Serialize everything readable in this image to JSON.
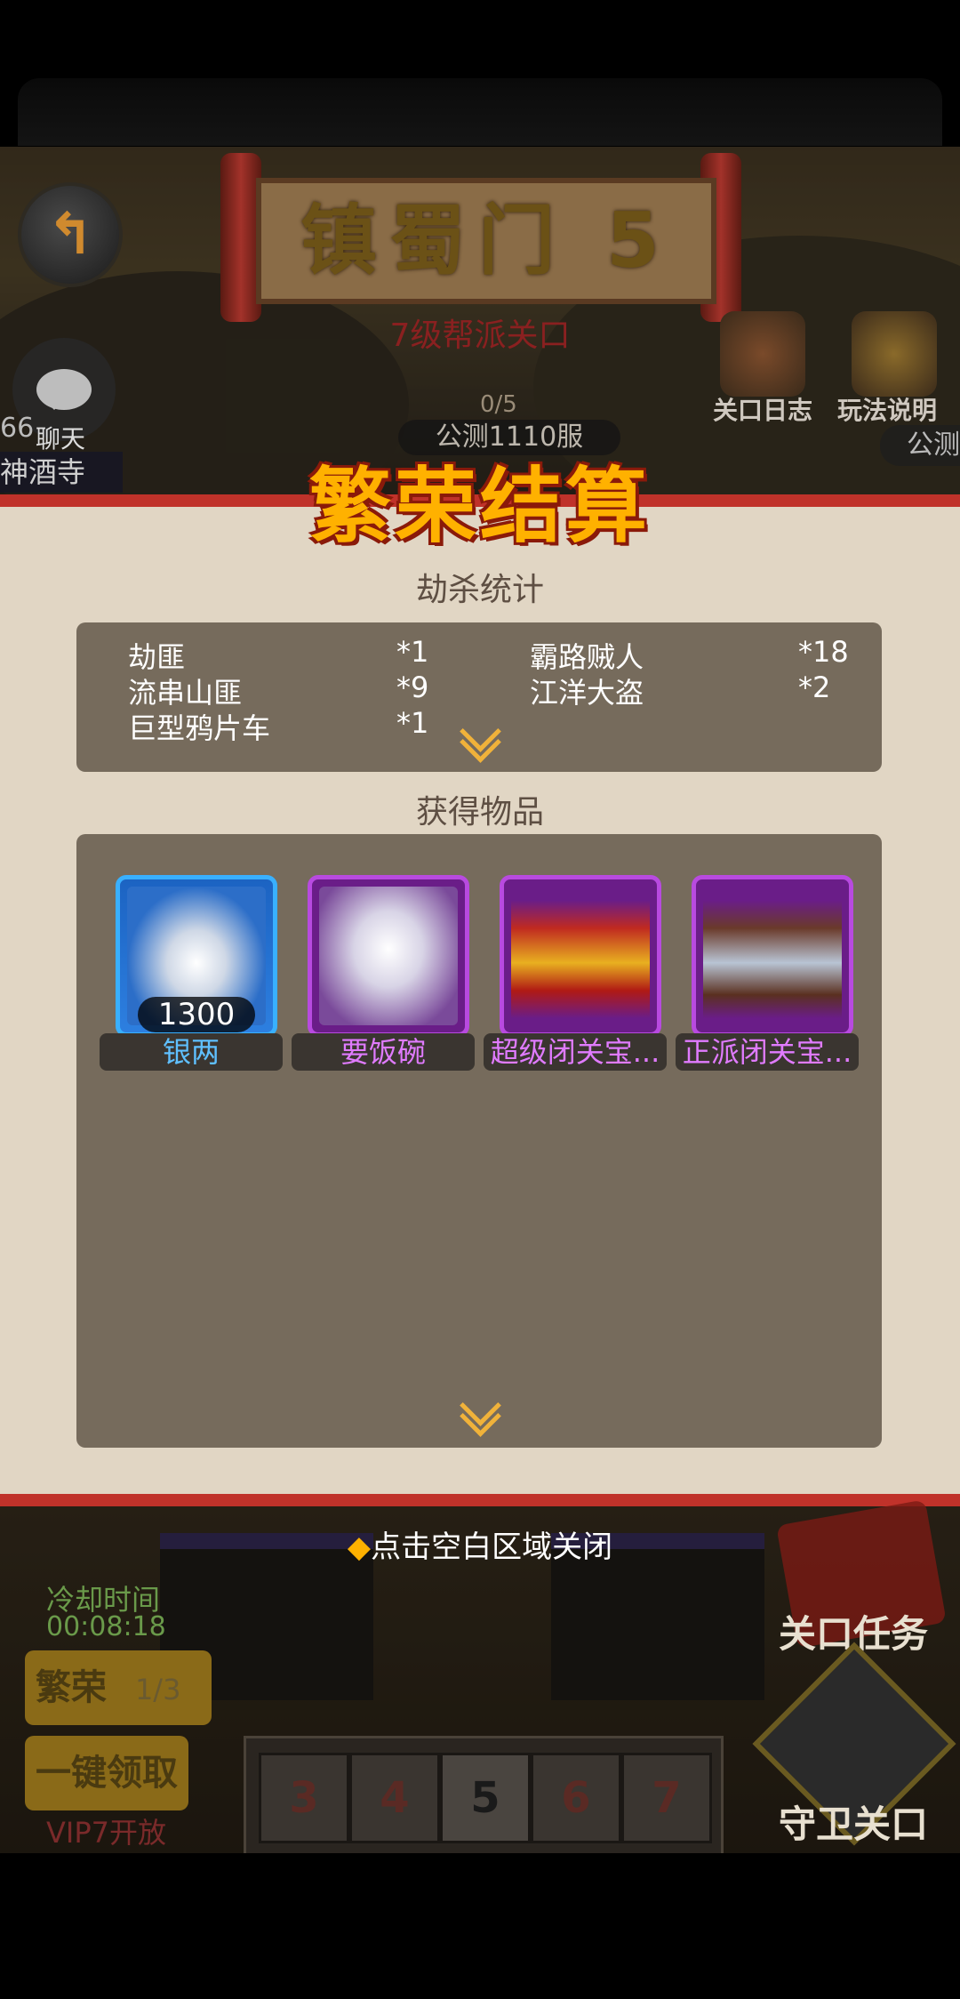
{
  "stage": {
    "title": "镇蜀门  5",
    "subtitle": "7级帮派关口",
    "progress": "0/5",
    "server": "公测1110服",
    "server_right": "公测",
    "chat_label": "聊天",
    "left_number": "66",
    "left_name": "神酒寺",
    "log_label": "关口日志",
    "rules_label": "玩法说明"
  },
  "panel": {
    "title": "繁荣结算",
    "kill_section": "劫杀统计",
    "items_section": "获得物品",
    "kills": [
      {
        "name": "劫匪",
        "count": "*1"
      },
      {
        "name": "霸路贼人",
        "count": "*18"
      },
      {
        "name": "流串山匪",
        "count": "*9"
      },
      {
        "name": "江洋大盗",
        "count": "*2"
      },
      {
        "name": "巨型鸦片车",
        "count": "*1"
      }
    ],
    "items": [
      {
        "name": "银两",
        "qty": "1300",
        "name_color": "#5fc0ff",
        "icon": "silver-ingot-icon"
      },
      {
        "name": "要饭碗",
        "qty": "",
        "name_color": "#e07bff",
        "icon": "beggar-bowl-icon"
      },
      {
        "name": "超级闭关宝...",
        "qty": "",
        "name_color": "#e07bff",
        "icon": "gold-chest-icon"
      },
      {
        "name": "正派闭关宝...",
        "qty": "",
        "name_color": "#e07bff",
        "icon": "silver-chest-icon"
      }
    ]
  },
  "close_hint": "点击空白区域关闭",
  "bottom": {
    "cooldown_label": "冷却时间",
    "cooldown_time": "00:08:18",
    "prosper_label": "繁荣",
    "prosper_count": "1/3",
    "claim_all": "一键领取",
    "vip_hint": "VIP7开放",
    "levels": [
      "3",
      "4",
      "5",
      "6",
      "7"
    ],
    "mission_label": "关口任务",
    "guard_label": "守卫关口"
  }
}
